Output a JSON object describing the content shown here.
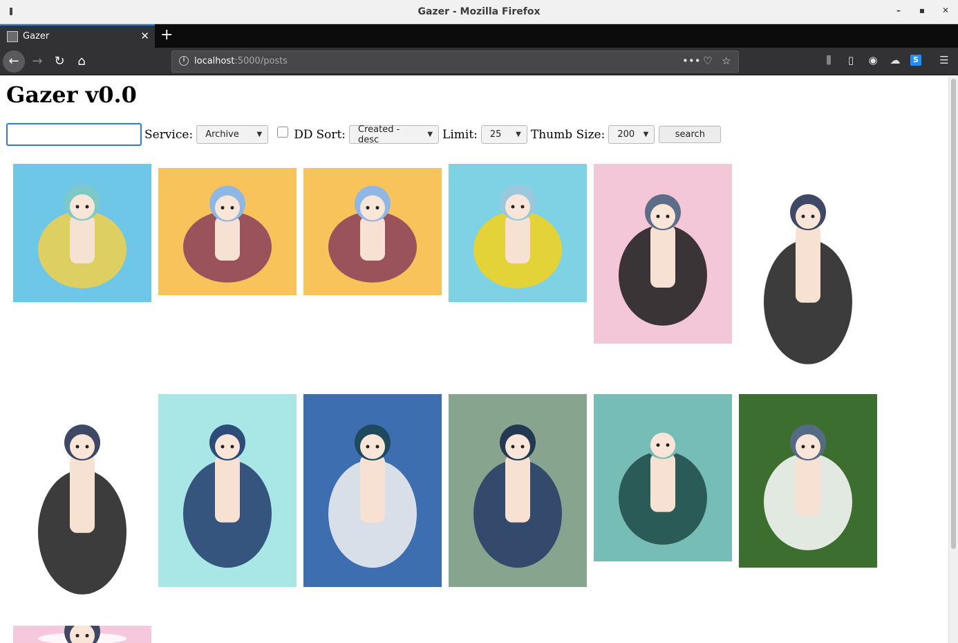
{
  "window": {
    "title": "Gazer - Mozilla Firefox"
  },
  "tab": {
    "label": "Gazer"
  },
  "url": {
    "host": "localhost",
    "rest": ":5000/posts"
  },
  "page": {
    "title": "Gazer v0.0"
  },
  "search": {
    "query": "",
    "service_label": "Service:",
    "service_value": "Archive",
    "dd_label": "DD",
    "sort_label": "Sort:",
    "sort_value": "Created - desc",
    "limit_label": "Limit:",
    "limit_value": "25",
    "thumb_label": "Thumb Size:",
    "thumb_value": "200",
    "search_button": "search"
  },
  "colors": {
    "accent": "#0a84ff",
    "input_focus": "#2a7ad6"
  },
  "thumbnails": [
    {
      "name": "thumb-1",
      "bg": "#6fc7e8",
      "accent": "#f2d04a",
      "hair": "#7fc8c8"
    },
    {
      "name": "thumb-2",
      "bg": "#f7c35a",
      "accent": "#8a3e5c",
      "hair": "#8fb7e6"
    },
    {
      "name": "thumb-3",
      "bg": "#f7c35a",
      "accent": "#8a3e5c",
      "hair": "#8fb7e6"
    },
    {
      "name": "thumb-4",
      "bg": "#7fd2e3",
      "accent": "#f5d21a",
      "hair": "#9cc8de"
    },
    {
      "name": "thumb-5",
      "bg": "#f3c6d8",
      "accent": "#1a1a1a",
      "hair": "#5d6d88"
    },
    {
      "name": "thumb-6",
      "bg": "#ffffff",
      "accent": "#1a1a1a",
      "hair": "#3f4966"
    },
    {
      "name": "thumb-7",
      "bg": "#ffffff",
      "accent": "#1a1a1a",
      "hair": "#3f4966"
    },
    {
      "name": "thumb-8",
      "bg": "#a9e6e6",
      "accent": "#213a6b",
      "hair": "#2d4c7a"
    },
    {
      "name": "thumb-9",
      "bg": "#3d6fb0",
      "accent": "#f3f3f3",
      "hair": "#1f4a5e"
    },
    {
      "name": "thumb-10",
      "bg": "#87a58e",
      "accent": "#253a66",
      "hair": "#243852"
    },
    {
      "name": "thumb-11",
      "bg": "#76bdb7",
      "accent": "#1f4a47",
      "hair": "#76bdb7"
    },
    {
      "name": "thumb-12",
      "bg": "#3c6e30",
      "accent": "#ffffff",
      "hair": "#556b84"
    },
    {
      "name": "thumb-13",
      "bg": "#f6c8de",
      "accent": "#ffffff",
      "hair": "#3f4966"
    }
  ]
}
